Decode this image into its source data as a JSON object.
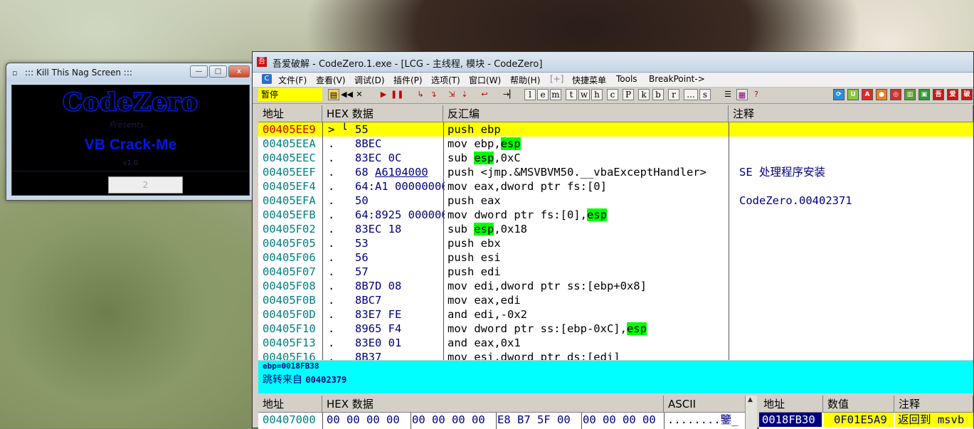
{
  "nag_window": {
    "title": "::: Kill This Nag Screen :::",
    "logo": "CodeZero",
    "presents": "Presents...",
    "heading": "VB Crack-Me",
    "version": "v1.0",
    "counter_button": "2",
    "min": "—",
    "max": "□",
    "close": "x"
  },
  "debugger": {
    "title": "吾爱破解 - CodeZero.1.exe - [LCG - 主线程, 模块 - CodeZero]",
    "app_icon": "吾",
    "menu": [
      "文件(F)",
      "查看(V)",
      "调试(D)",
      "插件(P)",
      "选项(T)",
      "窗口(W)",
      "帮助(H)",
      "[+]",
      "快捷菜单",
      "Tools",
      "BreakPoint->"
    ],
    "status": "暂停",
    "toolbar_letters": [
      "l",
      "e",
      "m",
      "t",
      "w",
      "h",
      "c",
      "P",
      "k",
      "b",
      "r",
      "...",
      "s"
    ],
    "cpu_headers": {
      "addr": "地址",
      "hex": "HEX 数据",
      "disasm": "反汇编",
      "comment": "注释"
    },
    "rows": [
      {
        "addr": "00405EE9",
        "mark": "> └",
        "hex": "55",
        "dis": "push ebp",
        "cmt": "",
        "cur": true
      },
      {
        "addr": "00405EEA",
        "mark": ".",
        "hex": "8BEC",
        "dis": "mov ebp,",
        "hl": "esp",
        "dis2": "",
        "cmt": ""
      },
      {
        "addr": "00405EEC",
        "mark": ".",
        "hex": "83EC 0C",
        "dis": "sub ",
        "hl": "esp",
        "dis2": ",0xC",
        "cmt": ""
      },
      {
        "addr": "00405EEF",
        "mark": ".",
        "hex": "68",
        "hex_ul": "A6104000",
        "dis": "push <jmp.&MSVBVM50.__vbaExceptHandler>",
        "cmt": "SE 处理程序安装"
      },
      {
        "addr": "00405EF4",
        "mark": ".",
        "hex": "64:A1 00000000",
        "dis": "mov eax,dword ptr fs:[0]",
        "cmt": ""
      },
      {
        "addr": "00405EFA",
        "mark": ".",
        "hex": "50",
        "dis": "push eax",
        "cmt": "CodeZero.00402371"
      },
      {
        "addr": "00405EFB",
        "mark": ".",
        "hex": "64:8925 000000",
        "dis": "mov dword ptr fs:[0],",
        "hl": "esp",
        "dis2": "",
        "cmt": ""
      },
      {
        "addr": "00405F02",
        "mark": ".",
        "hex": "83EC 18",
        "dis": "sub ",
        "hl": "esp",
        "dis2": ",0x18",
        "cmt": ""
      },
      {
        "addr": "00405F05",
        "mark": ".",
        "hex": "53",
        "dis": "push ebx",
        "cmt": ""
      },
      {
        "addr": "00405F06",
        "mark": ".",
        "hex": "56",
        "dis": "push esi",
        "cmt": ""
      },
      {
        "addr": "00405F07",
        "mark": ".",
        "hex": "57",
        "dis": "push edi",
        "cmt": ""
      },
      {
        "addr": "00405F08",
        "mark": ".",
        "hex": "8B7D 08",
        "dis": "mov edi,dword ptr ss:[ebp+0x8]",
        "cmt": ""
      },
      {
        "addr": "00405F0B",
        "mark": ".",
        "hex": "8BC7",
        "dis": "mov eax,edi",
        "cmt": ""
      },
      {
        "addr": "00405F0D",
        "mark": ".",
        "hex": "83E7 FE",
        "dis": "and edi,-0x2",
        "cmt": ""
      },
      {
        "addr": "00405F10",
        "mark": ".",
        "hex": "8965 F4",
        "dis": "mov dword ptr ss:[ebp-0xC],",
        "hl": "esp",
        "dis2": "",
        "cmt": ""
      },
      {
        "addr": "00405F13",
        "mark": ".",
        "hex": "83E0 01",
        "dis": "and eax,0x1",
        "cmt": ""
      },
      {
        "addr": "00405F16",
        "mark": ".",
        "hex": "8B37",
        "dis": "mov esi,dword ptr ds:[edi]",
        "cmt": ""
      }
    ],
    "info": {
      "line1": "ebp=0018FB38",
      "line2_prefix": "跳转来自 ",
      "line2_addr": "00402379"
    },
    "dump_headers": {
      "addr": "地址",
      "hex": "HEX 数据",
      "ascii": "ASCII"
    },
    "dump_row": {
      "addr": "00407000",
      "g1": "00 00 00 00",
      "g2": "00 00 00 00",
      "g3": "E8 B7 5F 00",
      "g4": "00 00 00 00",
      "ascii": "........鑒_"
    },
    "stack_headers": {
      "addr": "地址",
      "val": "数值",
      "cmt": "注释"
    },
    "stack_row": {
      "addr": "0018FB30",
      "val": "0F01E5A9",
      "cmt": "返回到 msvb"
    }
  },
  "colors": {
    "current_line": "#ffff00",
    "register_highlight": "#00ff00",
    "info_bg": "#00ffff",
    "addr_text": "#008080"
  }
}
